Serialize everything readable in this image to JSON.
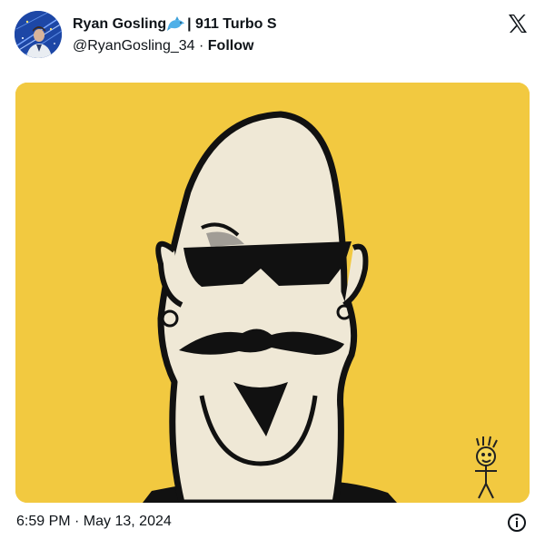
{
  "tweet": {
    "author_name": "Ryan Gosling",
    "author_suffix": "| 911 Turbo S",
    "handle": "@RyanGosling_34",
    "separator": "·",
    "follow_label": "Follow",
    "timestamp": "6:59 PM · May 13, 2024"
  },
  "icons": {
    "brand": "x-logo-icon",
    "emoji": "dolphin-icon",
    "info": "info-icon"
  },
  "colors": {
    "image_background": "#f1c63c",
    "text": "#0f1419"
  }
}
